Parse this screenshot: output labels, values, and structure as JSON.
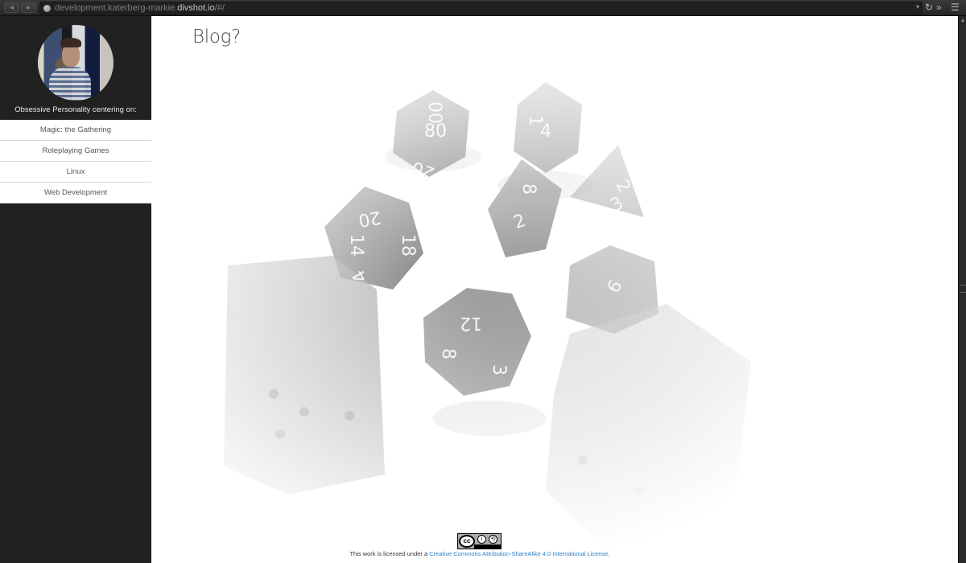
{
  "browser": {
    "url_prefix": "development.katerberg-markie.",
    "url_host": "divshot.io",
    "url_suffix": "/#/",
    "icons": [
      "back-icon",
      "forward-icon",
      "globe-icon",
      "dropdown-icon",
      "reload-icon",
      "overflow-icon",
      "menu-icon"
    ]
  },
  "sidebar": {
    "tagline": "Obsessive Personality centering on:",
    "items": [
      {
        "label": "Magic: the Gathering"
      },
      {
        "label": "Roleplaying Games"
      },
      {
        "label": "Linux"
      },
      {
        "label": "Web Development"
      }
    ]
  },
  "main": {
    "title": "Blog?",
    "license_prefix": "This work is licensed under a ",
    "license_link": "Creative Commons Attribution-ShareAlike 4.0 International License",
    "license_suffix": "."
  },
  "dice": {
    "labels": [
      "00",
      "80",
      "20",
      "4",
      "2",
      "8",
      "2",
      "3",
      "1",
      "20",
      "14",
      "18",
      "4",
      "12",
      "8",
      "3",
      "6"
    ]
  }
}
